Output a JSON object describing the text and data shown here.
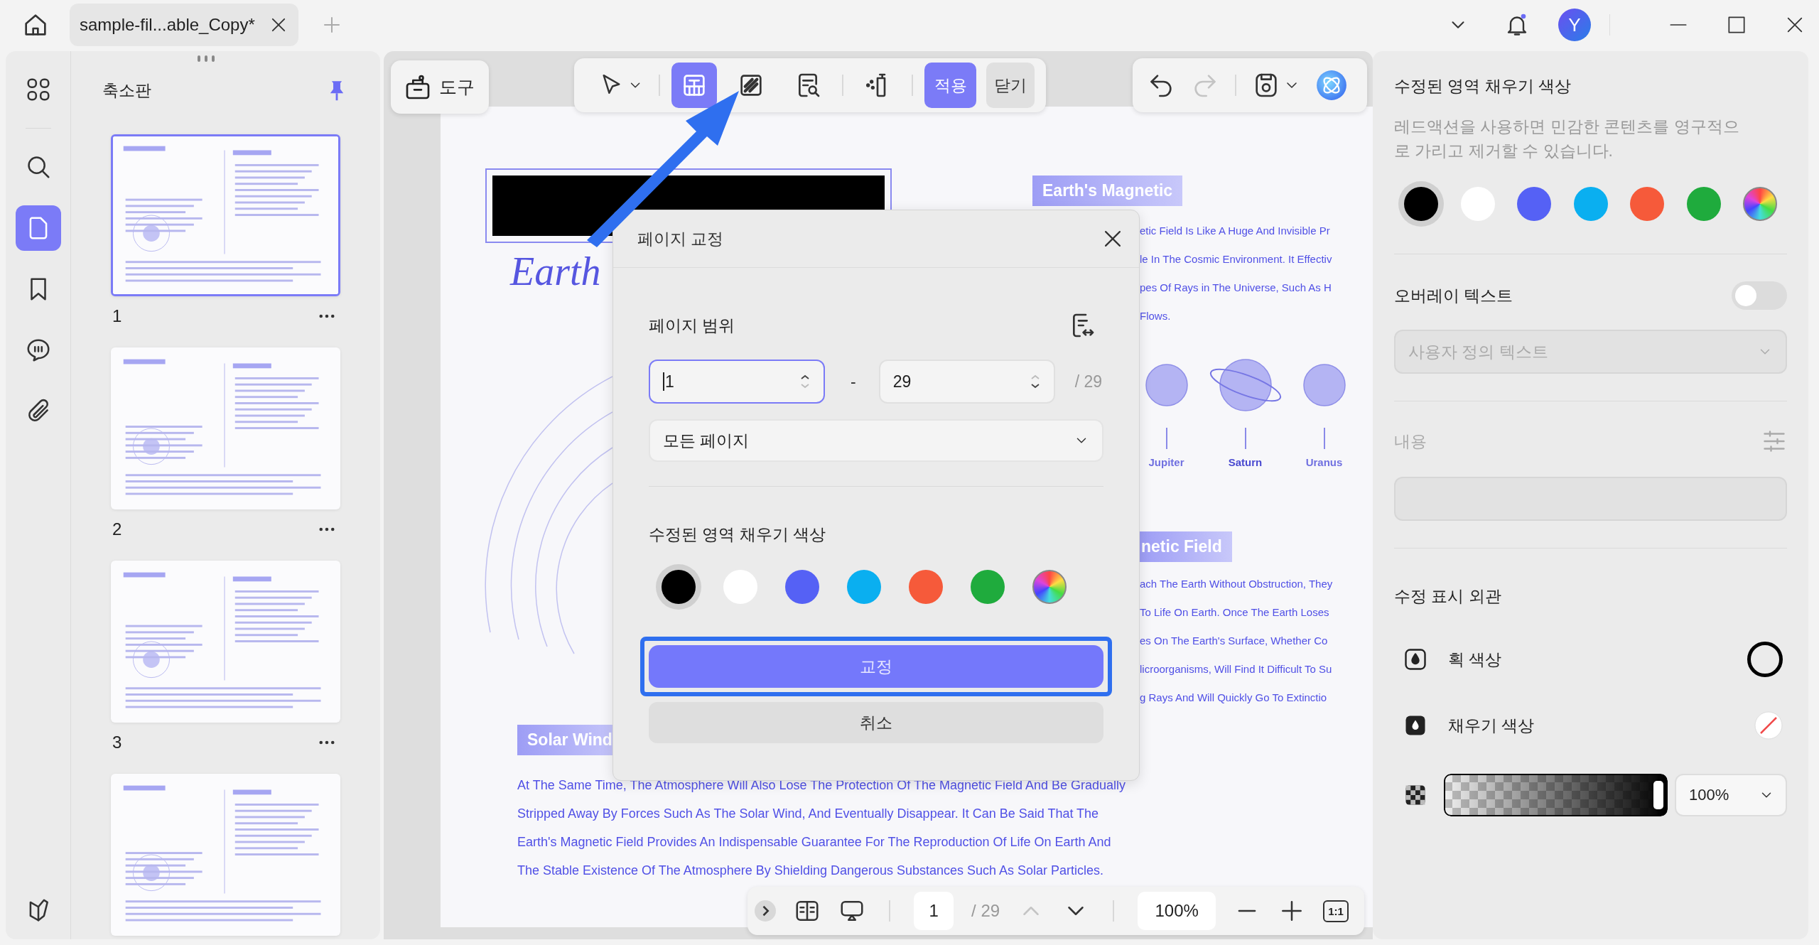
{
  "tab": {
    "title": "sample-fil...able_Copy*"
  },
  "user": {
    "initial": "Y"
  },
  "sidebar": {
    "items": [
      {
        "kind": "grid",
        "selected": false
      },
      {
        "kind": "search",
        "selected": false
      },
      {
        "kind": "pages",
        "selected": true
      },
      {
        "kind": "bookmark",
        "selected": false
      },
      {
        "kind": "comment",
        "selected": false
      },
      {
        "kind": "attachment",
        "selected": false
      }
    ]
  },
  "thumbnails": {
    "title": "축소판",
    "pages": [
      {
        "number": "1",
        "selected": true
      },
      {
        "number": "2",
        "selected": false
      },
      {
        "number": "3",
        "selected": false
      },
      {
        "selected": false
      }
    ]
  },
  "toolbar": {
    "tools_label": "도구",
    "tools": [
      {
        "kind": "select",
        "selected": false
      },
      {
        "kind": "redact",
        "selected": true
      },
      {
        "kind": "redact-pages",
        "selected": false
      },
      {
        "kind": "search-redact",
        "selected": false
      },
      {
        "kind": "sanitize",
        "selected": false
      }
    ],
    "apply": "적용",
    "close": "닫기"
  },
  "history": {
    "undo": {
      "disabled": false
    },
    "redo": {
      "disabled": true
    }
  },
  "document": {
    "title": "Earth",
    "heading_1": "Earth's Magnetic",
    "paragraph_1": [
      "etic Field Is Like A Huge And Invisible Pr",
      "le In The Cosmic Environment. It Effectiv",
      "pes Of Rays in The Universe, Such As H",
      "Flows."
    ],
    "planets": [
      {
        "name": "Jupiter",
        "ringed": false
      },
      {
        "name": "Saturn",
        "ringed": true
      },
      {
        "name": "Uranus",
        "ringed": false
      }
    ],
    "heading_2": "netic Field",
    "paragraph_2": [
      "ach The Earth Without Obstruction, They",
      "To Life On Earth. Once The Earth Loses",
      "es On The Earth's Surface, Whether Co",
      "licroorganisms, Will Find It Difficult To Su",
      "g Rays And Will Quickly Go To Extinctio"
    ],
    "heading_3": "Solar Wind",
    "paragraph_3": [
      "At The Same Time, The Atmosphere Will Also Lose The Protection Of The Magnetic Field And Be Gradually",
      "Stripped Away By Forces Such As The Solar Wind, And Eventually Disappear. It Can Be Said That The",
      "Earth's Magnetic Field Provides An Indispensable Guarantee For The Reproduction Of Life On Earth And",
      "The Stable Existence Of The Atmosphere By Shielding Dangerous Substances Such As Solar Particles."
    ]
  },
  "dialog": {
    "title": "페이지 교정",
    "range_label": "페이지 범위",
    "from": "1",
    "dash": "-",
    "to": "29",
    "total": "/ 29",
    "scope": "모든 페이지",
    "color_label": "수정된 영역 채우기 색상",
    "colors": [
      {
        "kind": "solid",
        "color": "#000000",
        "selected": true
      },
      {
        "kind": "solid",
        "color": "#ffffff",
        "selected": false
      },
      {
        "kind": "solid",
        "color": "#5561f5",
        "selected": false
      },
      {
        "kind": "solid",
        "color": "#0aaff0",
        "selected": false
      },
      {
        "kind": "solid",
        "color": "#f65a3a",
        "selected": false
      },
      {
        "kind": "solid",
        "color": "#1fab3d",
        "selected": false
      },
      {
        "kind": "spectrum",
        "selected": false
      }
    ],
    "confirm": "교정",
    "cancel": "취소"
  },
  "bottom_bar": {
    "page": "1",
    "total": "/ 29",
    "zoom": "100%",
    "fit": "1:1"
  },
  "right_panel": {
    "title": "수정된 영역 채우기 색상",
    "description": "레드액션을 사용하면 민감한 콘텐츠를 영구적으로 가리고 제거할 수 있습니다.",
    "colors": [
      {
        "kind": "solid",
        "color": "#000000",
        "selected": true
      },
      {
        "kind": "solid",
        "color": "#ffffff",
        "selected": false
      },
      {
        "kind": "solid",
        "color": "#5561f5",
        "selected": false
      },
      {
        "kind": "solid",
        "color": "#0aaff0",
        "selected": false
      },
      {
        "kind": "solid",
        "color": "#f65a3a",
        "selected": false
      },
      {
        "kind": "solid",
        "color": "#1fab3d",
        "selected": false
      },
      {
        "kind": "spectrum",
        "selected": false
      }
    ],
    "overlay": {
      "label": "오버레이 텍스트",
      "on": false,
      "placeholder": "사용자 정의 텍스트"
    },
    "content_label": "내용",
    "appearance_title": "수정 표시 외관",
    "stroke_label": "획 색상",
    "fill_label": "채우기 색상",
    "opacity": {
      "level": 1,
      "value": "100%"
    }
  }
}
